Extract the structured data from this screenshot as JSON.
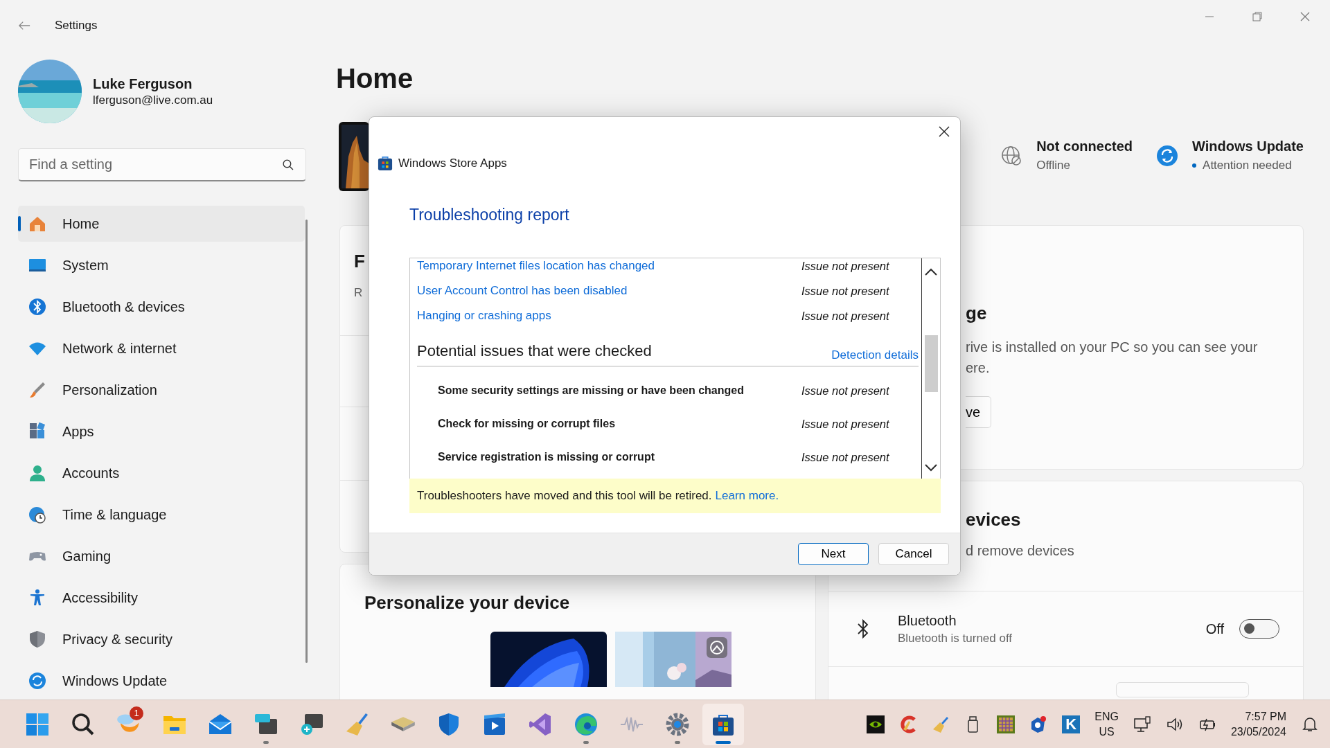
{
  "window": {
    "title": "Settings"
  },
  "profile": {
    "name": "Luke Ferguson",
    "email": "lferguson@live.com.au"
  },
  "search": {
    "placeholder": "Find a setting"
  },
  "nav": [
    {
      "label": "Home",
      "selected": true
    },
    {
      "label": "System",
      "selected": false
    },
    {
      "label": "Bluetooth & devices",
      "selected": false
    },
    {
      "label": "Network & internet",
      "selected": false
    },
    {
      "label": "Personalization",
      "selected": false
    },
    {
      "label": "Apps",
      "selected": false
    },
    {
      "label": "Accounts",
      "selected": false
    },
    {
      "label": "Time & language",
      "selected": false
    },
    {
      "label": "Gaming",
      "selected": false
    },
    {
      "label": "Accessibility",
      "selected": false
    },
    {
      "label": "Privacy & security",
      "selected": false
    },
    {
      "label": "Windows Update",
      "selected": false
    }
  ],
  "page_title": "Home",
  "status_items": [
    {
      "kind": "network",
      "title": "Not connected",
      "subtitle": "Offline",
      "attention": false
    },
    {
      "kind": "update",
      "title": "Windows Update",
      "subtitle": "Attention needed",
      "attention": true
    }
  ],
  "left_card": {
    "heading_fragment": "F",
    "text_fragment": "R"
  },
  "personalize": {
    "title": "Personalize your device"
  },
  "storage_card": {
    "title": "ge",
    "lines": [
      "rive is installed on your PC so you can see your",
      "ere."
    ],
    "button": "ve"
  },
  "devices_card": {
    "title": "evices",
    "subtitle": "d remove devices",
    "bluetooth": {
      "name": "Bluetooth",
      "status": "Bluetooth is turned off",
      "state_label": "Off",
      "on": false
    }
  },
  "dialog": {
    "title": "Windows Store Apps",
    "heading": "Troubleshooting report",
    "results": [
      {
        "label": "Temporary Internet files location has changed",
        "status": "Issue not present"
      },
      {
        "label": "User Account Control has been disabled",
        "status": "Issue not present"
      },
      {
        "label": "Hanging or crashing apps",
        "status": "Issue not present"
      }
    ],
    "section_title": "Potential issues that were checked",
    "details_link": "Detection details",
    "checks": [
      {
        "label": "Some security settings are missing or have been changed",
        "status": "Issue not present"
      },
      {
        "label": "Check for missing or corrupt files",
        "status": "Issue not present"
      },
      {
        "label": "Service registration is missing or corrupt",
        "status": "Issue not present"
      }
    ],
    "notice": {
      "text": "Troubleshooters have moved and this tool will be retired.",
      "link": "Learn more."
    },
    "buttons": [
      {
        "label": "Next",
        "default": true
      },
      {
        "label": "Cancel",
        "default": false
      }
    ]
  },
  "taskbar": {
    "apps": [
      {
        "kind": "start",
        "running": false,
        "active": false
      },
      {
        "kind": "search",
        "running": false,
        "active": false
      },
      {
        "kind": "weather",
        "badge": "1",
        "running": false,
        "active": false
      },
      {
        "kind": "folder",
        "running": false,
        "active": false
      },
      {
        "kind": "mail",
        "running": false,
        "active": false
      },
      {
        "kind": "keyboard",
        "running": true,
        "active": false
      },
      {
        "kind": "magnifier",
        "running": false,
        "active": false
      },
      {
        "kind": "broom",
        "running": false,
        "active": false
      },
      {
        "kind": "drive",
        "running": false,
        "active": false
      },
      {
        "kind": "shield",
        "running": false,
        "active": false
      },
      {
        "kind": "video",
        "running": false,
        "active": false
      },
      {
        "kind": "ribbon",
        "running": false,
        "active": false
      },
      {
        "kind": "browser",
        "running": true,
        "active": false
      },
      {
        "kind": "wave",
        "running": false,
        "active": false
      },
      {
        "kind": "gear",
        "running": true,
        "active": false
      },
      {
        "kind": "store",
        "running": true,
        "active": true
      }
    ],
    "tray": [
      {
        "kind": "eye"
      },
      {
        "kind": "cbroom"
      },
      {
        "kind": "broom"
      },
      {
        "kind": "usb"
      },
      {
        "kind": "grid"
      },
      {
        "kind": "gearshield"
      },
      {
        "kind": "letter",
        "label": "K"
      }
    ],
    "language": [
      "ENG",
      "US"
    ],
    "time": "7:57 PM",
    "date": "23/05/2024"
  }
}
